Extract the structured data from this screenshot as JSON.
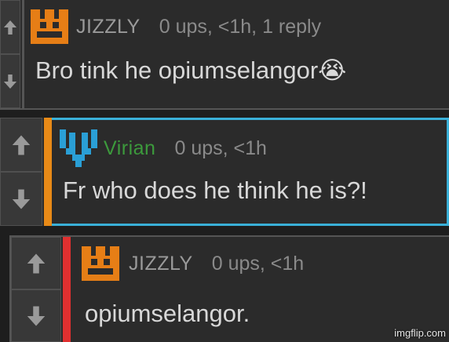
{
  "colors": {
    "jizzly_name": "#9a9a9a",
    "virian_name": "#3c9a3c",
    "jizzly_avatar": "#e67e16",
    "virian_avatar": "#2a9fd6",
    "reply_bar_orange": "#e88a17",
    "reply_bar_red": "#e03030",
    "highlight_border": "#3ab0d8"
  },
  "comments": [
    {
      "username": "JIZZLY",
      "meta": "0 ups, <1h, 1 reply",
      "text": "Bro tink he opiumselangor😭",
      "avatar_icon": "pixel-face-icon"
    },
    {
      "username": "Virian",
      "meta": "0 ups, <1h",
      "text": "Fr who does he think he is?!",
      "avatar_icon": "pixel-v-icon"
    },
    {
      "username": "JIZZLY",
      "meta": "0 ups, <1h",
      "text": "opiumselangor.",
      "avatar_icon": "pixel-face-icon"
    }
  ],
  "vote_icons": {
    "up": "arrow-up-icon",
    "down": "arrow-down-icon"
  },
  "watermark": "imgflip.com"
}
